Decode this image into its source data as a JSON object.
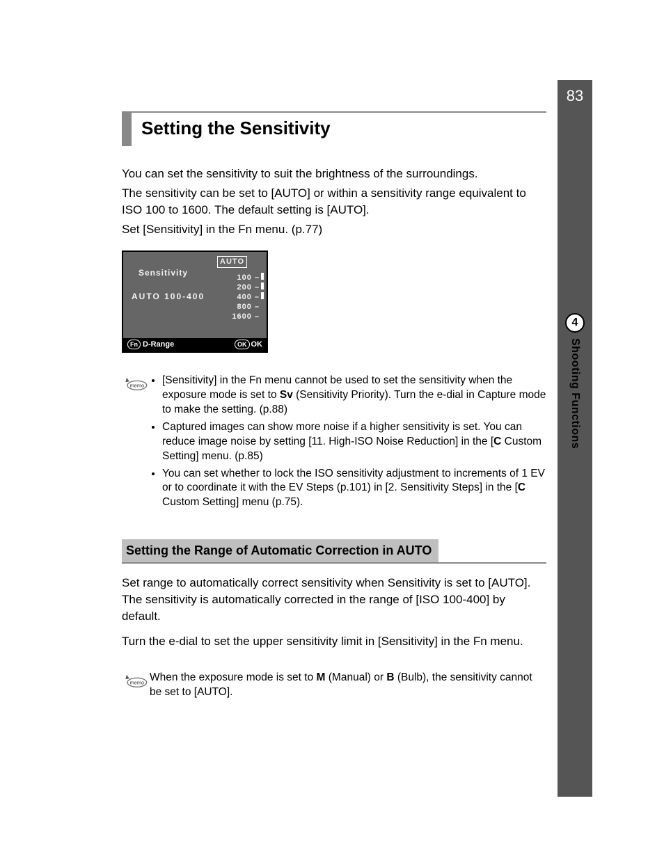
{
  "page_number": "83",
  "chapter_number": "4",
  "tab_label": "Shooting Functions",
  "heading": "Setting the Sensitivity",
  "intro": {
    "p1": "You can set the sensitivity to suit the brightness of the surroundings.",
    "p2": "The sensitivity can be set to [AUTO] or within a sensitivity range equivalent to ISO 100 to 1600. The default setting is [AUTO].",
    "p3": "Set [Sensitivity] in the Fn menu. (p.77)"
  },
  "lcd": {
    "auto_label": "AUTO",
    "title": "Sensitivity",
    "auto_range": "AUTO 100-400",
    "scale": [
      "100 –",
      "200 –",
      "400 –",
      "800 –",
      "1600 –"
    ],
    "footer_left_badge": "Fn",
    "footer_left": "D-Range",
    "footer_right_badge": "OK",
    "footer_right": "OK"
  },
  "memo1": {
    "b1a": "[Sensitivity] in the Fn menu cannot be used to set the sensitivity when the exposure mode is set to ",
    "b1_sv": "Sv",
    "b1b": " (Sensitivity Priority). Turn the e-dial in Capture mode to make the setting. (p.88)",
    "b2a": "Captured images can show more noise if a higher sensitivity is set. You can reduce image noise by setting [11. High-ISO Noise Reduction] in the [",
    "b2_c": "C",
    "b2b": " Custom Setting] menu. (p.85)",
    "b3a": "You can set whether to lock the ISO sensitivity adjustment to increments of 1 EV or to coordinate it with the EV Steps (p.101) in [2. Sensitivity Steps] in the [",
    "b3_c": "C",
    "b3b": " Custom Setting] menu (p.75)."
  },
  "subheading": "Setting the Range of Automatic Correction in AUTO",
  "sub_intro": {
    "p1": "Set range to automatically correct sensitivity when Sensitivity is set to [AUTO]. The sensitivity is automatically corrected in the range of [ISO 100-400] by default.",
    "p2": "Turn the e-dial to set the upper sensitivity limit in [Sensitivity] in the Fn menu."
  },
  "memo2": {
    "a": "When the exposure mode is set to ",
    "m": "M",
    "mid": " (Manual) or ",
    "b": "B",
    "b2": " (Bulb), the sensitivity cannot be set to [AUTO]."
  },
  "memo_label": "memo"
}
